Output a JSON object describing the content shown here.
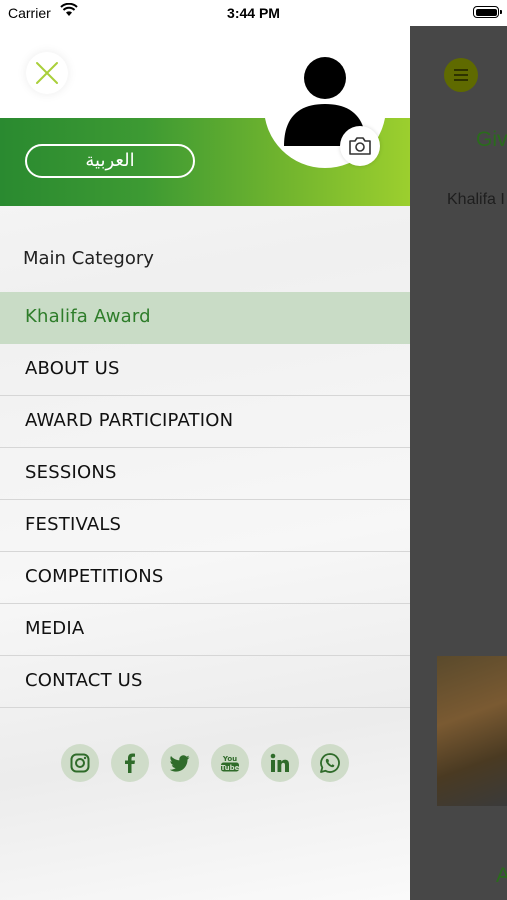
{
  "status_bar": {
    "carrier": "Carrier",
    "time": "3:44 PM"
  },
  "drawer": {
    "language_button": "العربية",
    "main_category_label": "Main Category",
    "menu_items": [
      {
        "label": "Khalifa Award",
        "active": true
      },
      {
        "label": "ABOUT US"
      },
      {
        "label": "AWARD PARTICIPATION"
      },
      {
        "label": "SESSIONS"
      },
      {
        "label": "FESTIVALS"
      },
      {
        "label": "COMPETITIONS"
      },
      {
        "label": "MEDIA"
      },
      {
        "label": "CONTACT US"
      }
    ],
    "social_icons": [
      "instagram-icon",
      "facebook-icon",
      "twitter-icon",
      "youtube-icon",
      "linkedin-icon",
      "whatsapp-icon"
    ]
  },
  "background_app": {
    "heading_fragment": "Giv",
    "subtitle_fragment": "Khalifa I",
    "bottom_fragment": "A"
  },
  "colors": {
    "accent_green": "#2e7d2a",
    "gradient_start": "#2a8a30",
    "gradient_end": "#9ccf2e",
    "active_row": "#c9dcc6",
    "social_bg": "#cfdcc9",
    "icon_green": "#2f6b2a"
  }
}
